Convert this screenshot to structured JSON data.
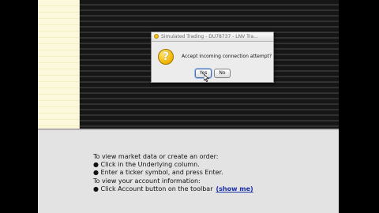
{
  "dialog": {
    "title": "Simulated Trading - DU78737 - LNV Tra...",
    "message": "Accept incoming connection attempt?",
    "question_glyph": "?",
    "yes_label": "Yes",
    "no_label": "No"
  },
  "info": {
    "line1": "To view market data or create an order:",
    "line2": "● Click in the Underlying column.",
    "line3": "● Enter a ticker symbol, and press Enter.",
    "line4": "To view your account information:",
    "line5": "● Click Account button on the toolbar",
    "show_me": "(show me)"
  },
  "icons": {
    "title": "app-warning-icon",
    "dialog": "question-icon",
    "pointer": "mouse-cursor-icon"
  },
  "colors": {
    "left_pane": "#fbf8dc",
    "grid_dark": "#1b1b1b",
    "info_panel": "#e2e3e2",
    "link": "#1a2fa8",
    "question": "#f0b400"
  }
}
